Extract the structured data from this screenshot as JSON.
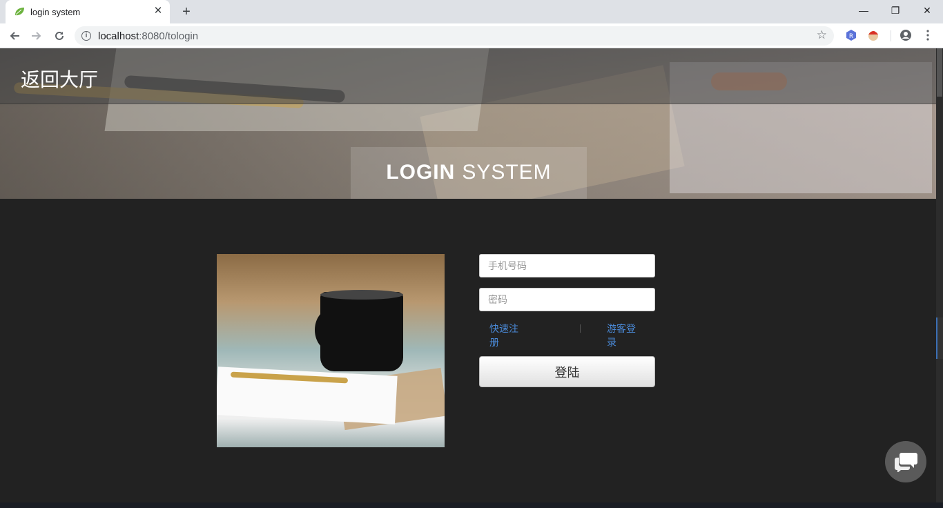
{
  "browser": {
    "tab_title": "login system",
    "tab_close": "✕",
    "new_tab": "+",
    "window_controls": {
      "minimize": "—",
      "restore": "❐",
      "close": "✕"
    },
    "url_host": "localhost",
    "url_path": ":8080/tologin",
    "icons": [
      "leaf-favicon-icon",
      "back-arrow-icon",
      "forward-arrow-icon",
      "reload-icon",
      "info-icon",
      "star-icon",
      "extension-r-icon",
      "extension-avatar-icon",
      "profile-icon",
      "menu-icon"
    ]
  },
  "page": {
    "back_link": "返回大厅",
    "title_bold": "LOGIN",
    "title_light": "SYSTEM",
    "form": {
      "phone_placeholder": "手机号码",
      "password_placeholder": "密码",
      "register_link": "快速注册",
      "guest_link": "游客登录",
      "submit_label": "登陆"
    },
    "chat_icon": "chat-bubbles-icon"
  },
  "colors": {
    "page_bg": "#222222",
    "link": "#4a8ad8",
    "accent_scroll": "#3b6fb5"
  }
}
